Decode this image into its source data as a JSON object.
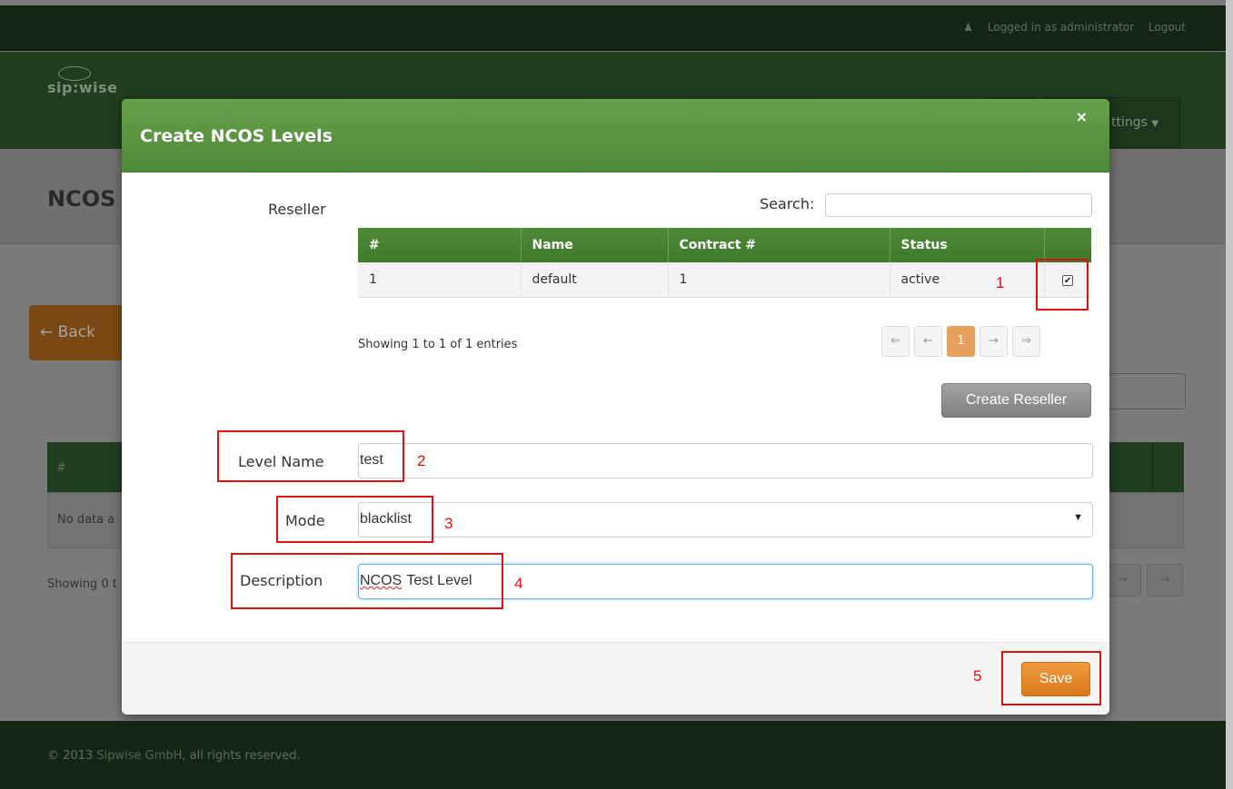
{
  "topbar": {
    "logged_in": "Logged in as administrator",
    "logout": "Logout"
  },
  "navbar": {
    "logo": "sip:wise",
    "settings_partial": "ttings"
  },
  "background": {
    "page_title_partial": "NCOS",
    "back_partial": "Back",
    "table_header_hash": "#",
    "no_data_partial": "No data a",
    "showing_partial": "Showing 0 t",
    "pager_next": "→",
    "pager_last": "⇒"
  },
  "modal": {
    "title": "Create NCOS Levels",
    "close": "×",
    "reseller_label": "Reseller",
    "search_label": "Search:",
    "search_value": "",
    "table": {
      "headers": [
        "#",
        "Name",
        "Contract #",
        "Status",
        ""
      ],
      "rows": [
        {
          "id": "1",
          "name": "default",
          "contract": "1",
          "status": "active",
          "checked": "✔"
        }
      ]
    },
    "entries_info": "Showing 1 to 1 of 1 entries",
    "pager": [
      "⇐",
      "←",
      "1",
      "→",
      "⇒"
    ],
    "create_reseller": "Create Reseller",
    "level_name_label": "Level Name",
    "level_name_value": "test",
    "mode_label": "Mode",
    "mode_value": "blacklist",
    "description_label": "Description",
    "description_value_word1": "NCOS",
    "description_value_rest": " Test Level",
    "save": "Save"
  },
  "annotations": [
    "1",
    "2",
    "3",
    "4",
    "5"
  ],
  "footer": {
    "copyright_prefix": "© 2013 ",
    "company": "Sipwise GmbH",
    "copyright_suffix": ", all rights reserved."
  },
  "colors": {
    "header_green": "#5c963f",
    "save_orange": "#e88a2a",
    "annotation_red": "#e01010"
  }
}
